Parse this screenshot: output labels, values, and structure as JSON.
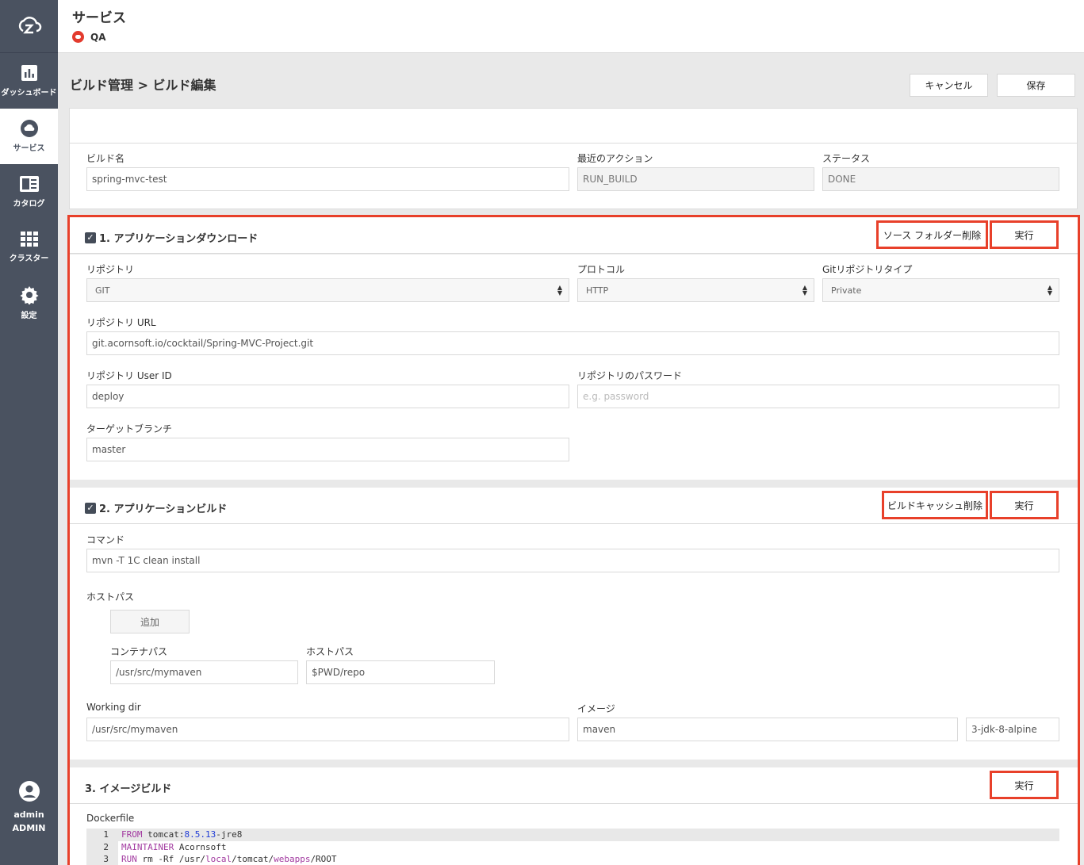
{
  "sidebar": {
    "items": [
      {
        "label": "ダッシュボード",
        "icon": "bar-chart-icon"
      },
      {
        "label": "サービス",
        "icon": "cloud-icon"
      },
      {
        "label": "カタログ",
        "icon": "catalog-icon"
      },
      {
        "label": "クラスター",
        "icon": "grid-icon"
      },
      {
        "label": "設定",
        "icon": "gear-icon"
      }
    ],
    "user": {
      "name": "admin",
      "role": "ADMIN"
    }
  },
  "header": {
    "title": "サービス",
    "service": "QA"
  },
  "page": {
    "title": "ビルド管理 > ビルド編集",
    "cancel": "キャンセル",
    "save": "保存"
  },
  "info": {
    "build_name_label": "ビルド名",
    "build_name": "spring-mvc-test",
    "action_label": "最近のアクション",
    "action": "RUN_BUILD",
    "status_label": "ステータス",
    "status": "DONE"
  },
  "step1": {
    "title": "1. アプリケーションダウンロード",
    "btn_delete": "ソース フォルダー削除",
    "btn_run": "実行",
    "repo_label": "リポジトリ",
    "repo": "GIT",
    "protocol_label": "プロトコル",
    "protocol": "HTTP",
    "repo_type_label": "Gitリポジトリタイプ",
    "repo_type": "Private",
    "url_label": "リポジトリ URL",
    "url": "git.acornsoft.io/cocktail/Spring-MVC-Project.git",
    "userid_label": "リポジトリ User ID",
    "userid": "deploy",
    "password_label": "リポジトリのパスワード",
    "password_placeholder": "e.g. password",
    "branch_label": "ターゲットブランチ",
    "branch": "master"
  },
  "step2": {
    "title": "2. アプリケーションビルド",
    "btn_delete": "ビルドキャッシュ削除",
    "btn_run": "実行",
    "command_label": "コマンド",
    "command": "mvn -T 1C clean install",
    "hostpath_label": "ホストパス",
    "add": "追加",
    "container_path_label": "コンテナパス",
    "container_path": "/usr/src/mymaven",
    "host_path_label": "ホストパス",
    "host_path": "$PWD/repo",
    "workdir_label": "Working dir",
    "workdir": "/usr/src/mymaven",
    "image_label": "イメージ",
    "image": "maven",
    "image_tag": "3-jdk-8-alpine"
  },
  "step3": {
    "title": "3. イメージビルド",
    "btn_run": "実行",
    "dockerfile_label": "Dockerfile",
    "lines": [
      "1",
      "2",
      "3"
    ]
  }
}
